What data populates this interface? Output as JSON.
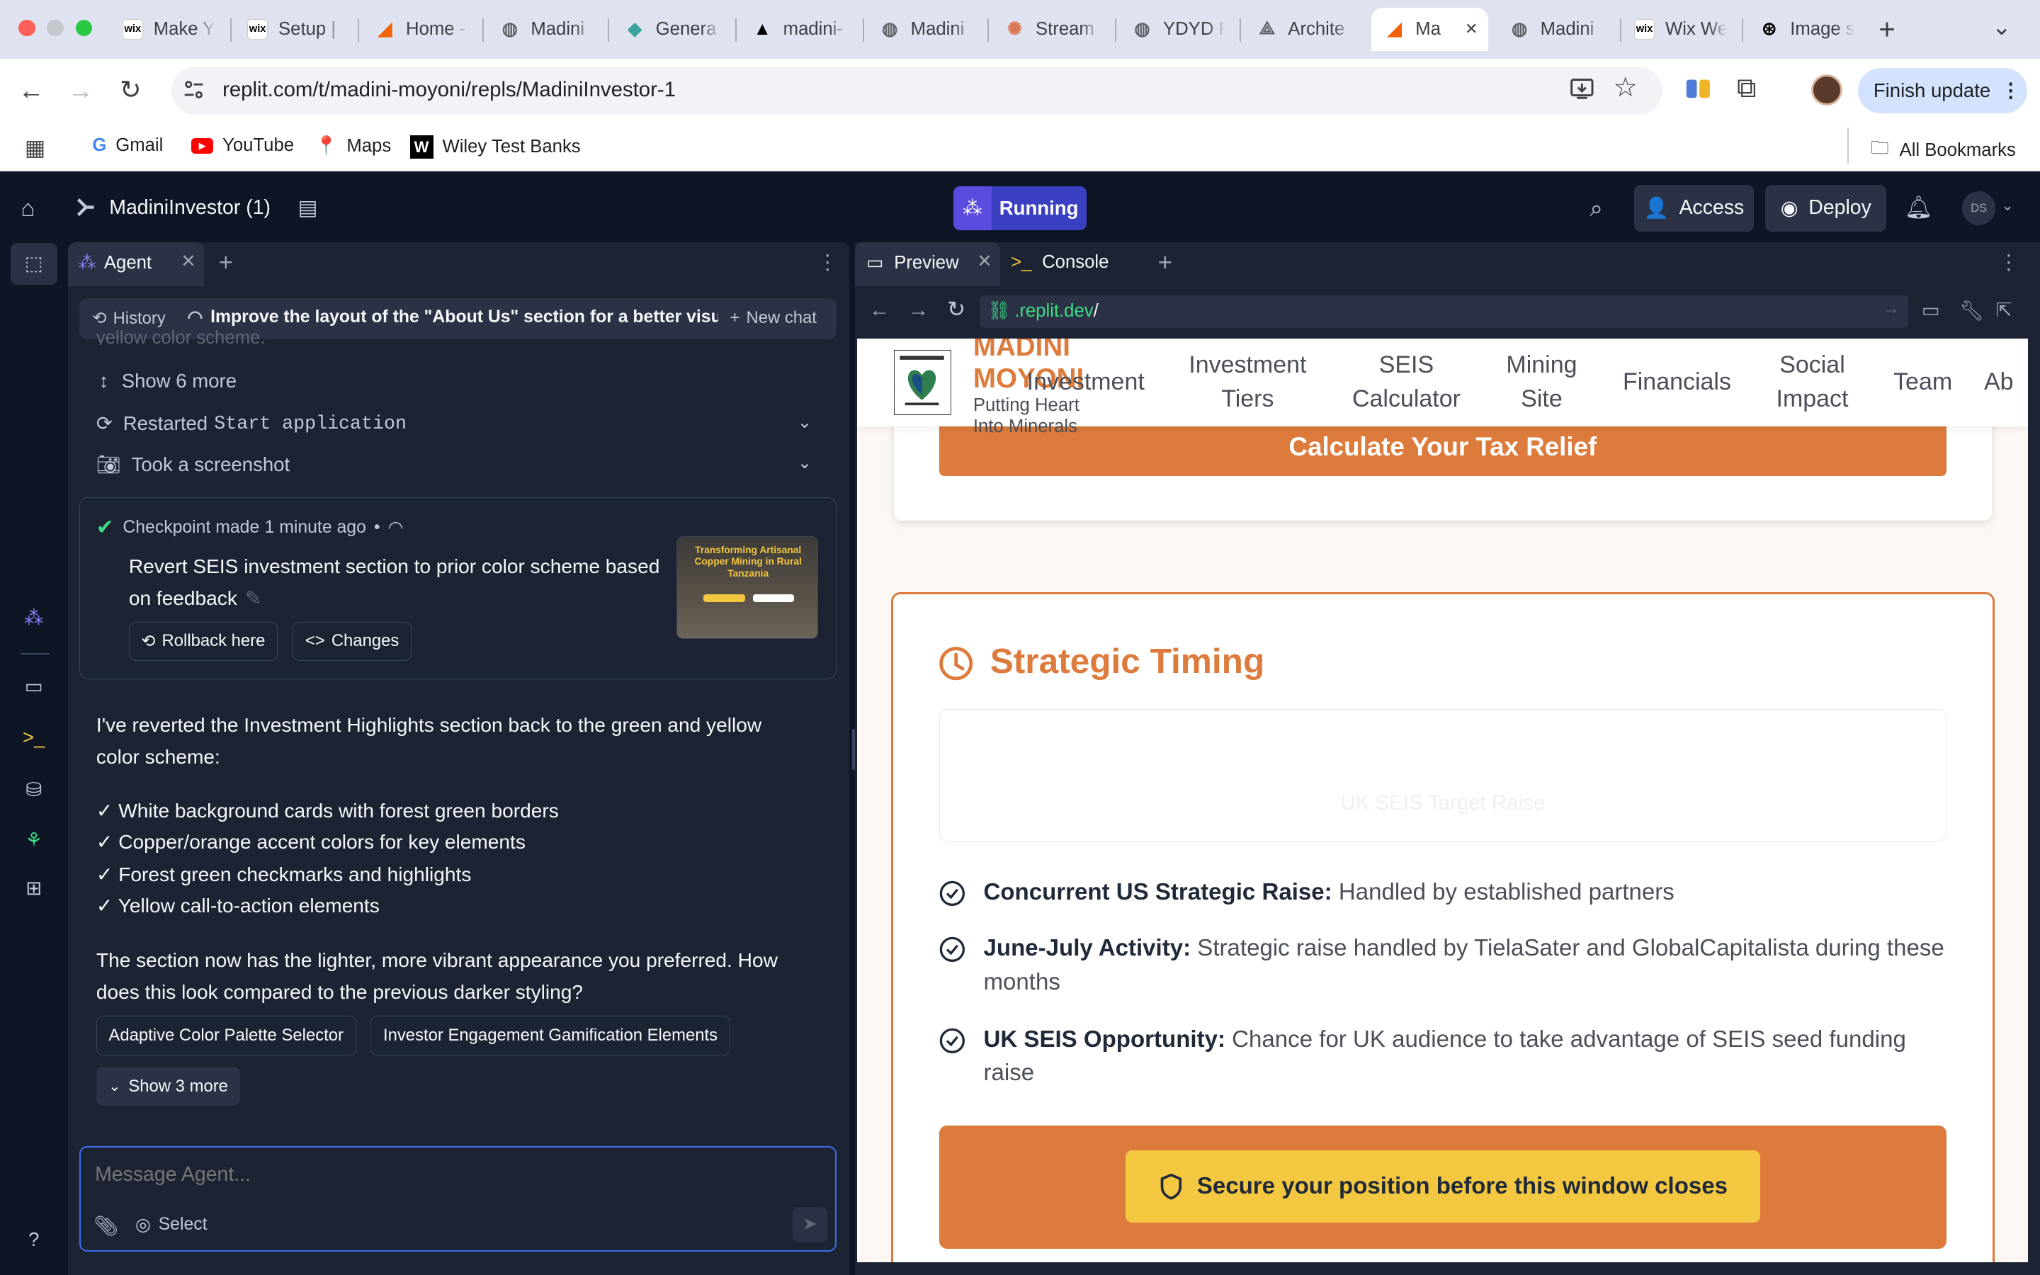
{
  "browser": {
    "tabs": [
      {
        "label": "Make Y",
        "icon": "wix-icon",
        "color": "#000000"
      },
      {
        "label": "Setup |",
        "icon": "wix-icon",
        "color": "#000000"
      },
      {
        "label": "Home -",
        "icon": "replit-icon",
        "color": "#f26207"
      },
      {
        "label": "Madini",
        "icon": "globe-icon",
        "color": "#5f6368"
      },
      {
        "label": "Genera",
        "icon": "diamond-icon",
        "color": "#3aa39c"
      },
      {
        "label": "madini-",
        "icon": "vercel-icon",
        "color": "#000000"
      },
      {
        "label": "Madini",
        "icon": "globe-icon",
        "color": "#5f6368"
      },
      {
        "label": "Stream",
        "icon": "claude-icon",
        "color": "#d97757"
      },
      {
        "label": "YDYD P",
        "icon": "globe-icon",
        "color": "#5f6368"
      },
      {
        "label": "Archite",
        "icon": "architect-icon",
        "color": "#5f6368"
      },
      {
        "label": "Ma",
        "icon": "replit-icon",
        "color": "#f26207"
      },
      {
        "label": "Madini",
        "icon": "globe-icon",
        "color": "#5f6368"
      },
      {
        "label": "Wix We",
        "icon": "wix-icon",
        "color": "#000000"
      },
      {
        "label": "Image s",
        "icon": "openai-icon",
        "color": "#000000"
      }
    ],
    "url": "replit.com/t/madini-moyoni/repls/MadiniInvestor-1",
    "finish_update": "Finish update",
    "bookmarks": [
      "Gmail",
      "YouTube",
      "Maps",
      "Wiley Test Banks"
    ],
    "all_bookmarks": "All Bookmarks"
  },
  "replit": {
    "project_name": "MadiniInvestor (1)",
    "run_status": "Running",
    "access_label": "Access",
    "deploy_label": "Deploy",
    "avatar_initials": "DS"
  },
  "agent": {
    "tab_label": "Agent",
    "history_label": "History",
    "chat_title": "Improve the layout of the \"About Us\" section for a better visua...",
    "new_chat": "New chat",
    "faded_text": "yellow color scheme.",
    "show_more": "Show 6 more",
    "restarted_label": "Restarted",
    "restarted_code": "Start application",
    "screenshot_label": "Took a screenshot",
    "checkpoint_label": "Checkpoint made",
    "checkpoint_time": "1 minute ago",
    "checkpoint_bullet": "•",
    "checkpoint_desc": "Revert SEIS investment section to prior color scheme based on feedback",
    "rollback_label": "Rollback here",
    "changes_label": "Changes",
    "thumb_title": "Transforming Artisanal Copper Mining in Rural Tanzania",
    "reply_intro": "I've reverted the Investment Highlights section back to the green and yellow color scheme:",
    "reply_points": [
      "✓ White background cards with forest green borders",
      "✓ Copper/orange accent colors for key elements",
      "✓ Forest green checkmarks and highlights",
      "✓ Yellow call-to-action elements"
    ],
    "reply_outro": "The section now has the lighter, more vibrant appearance you preferred. How does this look compared to the previous darker styling?",
    "suggestions": [
      "Adaptive Color Palette Selector",
      "Investor Engagement Gamification Elements"
    ],
    "show_3_more": "Show 3 more",
    "input_placeholder": "Message Agent...",
    "select_label": "Select"
  },
  "preview": {
    "preview_tab": "Preview",
    "console_tab": "Console",
    "url_domain": ".replit.dev",
    "url_path": "/",
    "site": {
      "brand_name": "MADINI MOYONI",
      "tagline": "Putting Heart Into Minerals",
      "nav": [
        "Investment",
        "Investment Tiers",
        "SEIS Calculator",
        "Mining Site",
        "Financials",
        "Social Impact",
        "Team",
        "Ab"
      ],
      "calc_button": "Calculate Your Tax Relief",
      "section_title": "Strategic Timing",
      "target_label": "UK SEIS Target Raise",
      "points": [
        {
          "title": "Concurrent US Strategic Raise:",
          "text": "Handled by established partners"
        },
        {
          "title": "June-July Activity:",
          "text": "Strategic raise handled by TielaSater and GlobalCapitalista during these months"
        },
        {
          "title": "UK SEIS Opportunity:",
          "text": "Chance for UK audience to take advantage of SEIS seed funding raise"
        }
      ],
      "cta": "Secure your position before this window closes",
      "colors": {
        "copper": "#dd7b3c",
        "yellow": "#f3c73f",
        "dark": "#1f2937"
      }
    }
  }
}
